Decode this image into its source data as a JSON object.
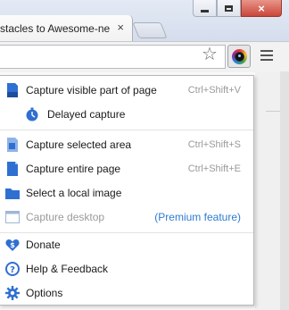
{
  "browser": {
    "tab_title": "stacles to Awesome-ne",
    "tab_close": "×",
    "window_minimize": "_",
    "window_maximize": "□",
    "window_close": "×",
    "bookmark_star": "☆"
  },
  "menu": {
    "capture_visible": {
      "label": "Capture visible part of page",
      "shortcut": "Ctrl+Shift+V"
    },
    "delayed_capture": {
      "label": "Delayed capture"
    },
    "capture_selected": {
      "label": "Capture selected area",
      "shortcut": "Ctrl+Shift+S"
    },
    "capture_entire": {
      "label": "Capture entire page",
      "shortcut": "Ctrl+Shift+E"
    },
    "select_local": {
      "label": "Select a local image"
    },
    "capture_desktop": {
      "label": "Capture desktop",
      "note": "(Premium feature)"
    },
    "donate": {
      "label": "Donate"
    },
    "help": {
      "label": "Help & Feedback"
    },
    "options": {
      "label": "Options"
    }
  },
  "colors": {
    "icon_blue": "#2f6fd1",
    "premium_link": "#2e7bd2",
    "disabled_text": "#9a9a9a"
  }
}
